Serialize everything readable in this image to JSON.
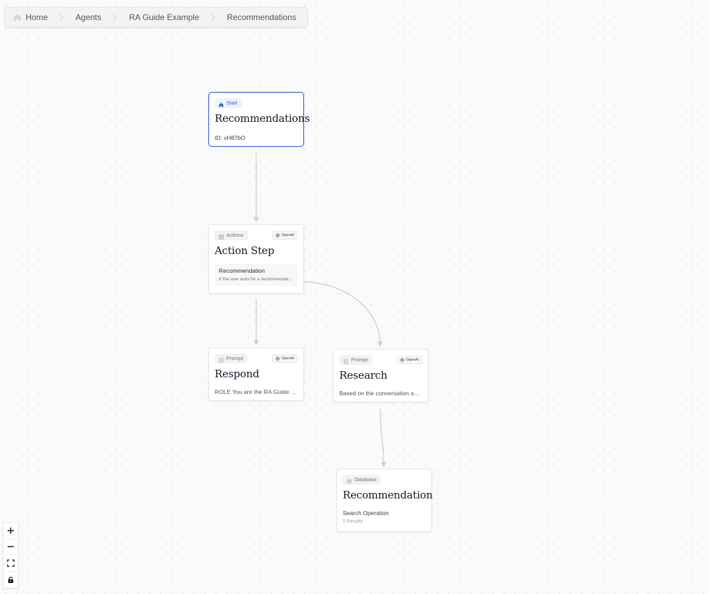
{
  "breadcrumb": {
    "items": [
      {
        "label": "Home",
        "icon": "home-icon"
      },
      {
        "label": "Agents"
      },
      {
        "label": "RA Guide Example"
      },
      {
        "label": "Recommendations"
      }
    ]
  },
  "nodes": {
    "start": {
      "tag": "Start",
      "title": "Recommendations",
      "id_text": "ID: vH87bO"
    },
    "action": {
      "tag": "Actions",
      "provider": "OpenAI",
      "title": "Action Step",
      "action_title": "Recommendation",
      "action_desc": "If the user asks for a recommendation..."
    },
    "respond": {
      "tag": "Prompt",
      "provider": "OpenAI",
      "title": "Respond",
      "text": "ROLE You are the RA Guide Agent..."
    },
    "research": {
      "tag": "Prompt",
      "provider": "OpenAI",
      "title": "Research",
      "text": "Based on the conversation above..."
    },
    "database": {
      "tag": "Database",
      "title": "Recommendation",
      "text": "Search Operation",
      "subtext": "5 Results"
    }
  },
  "controls": [
    {
      "name": "zoom-in-icon"
    },
    {
      "name": "zoom-out-icon"
    },
    {
      "name": "fit-view-icon"
    },
    {
      "name": "lock-icon"
    }
  ],
  "colors": {
    "accent": "#3b5bdb",
    "edge": "#c9cace",
    "background": "#fafafa"
  }
}
